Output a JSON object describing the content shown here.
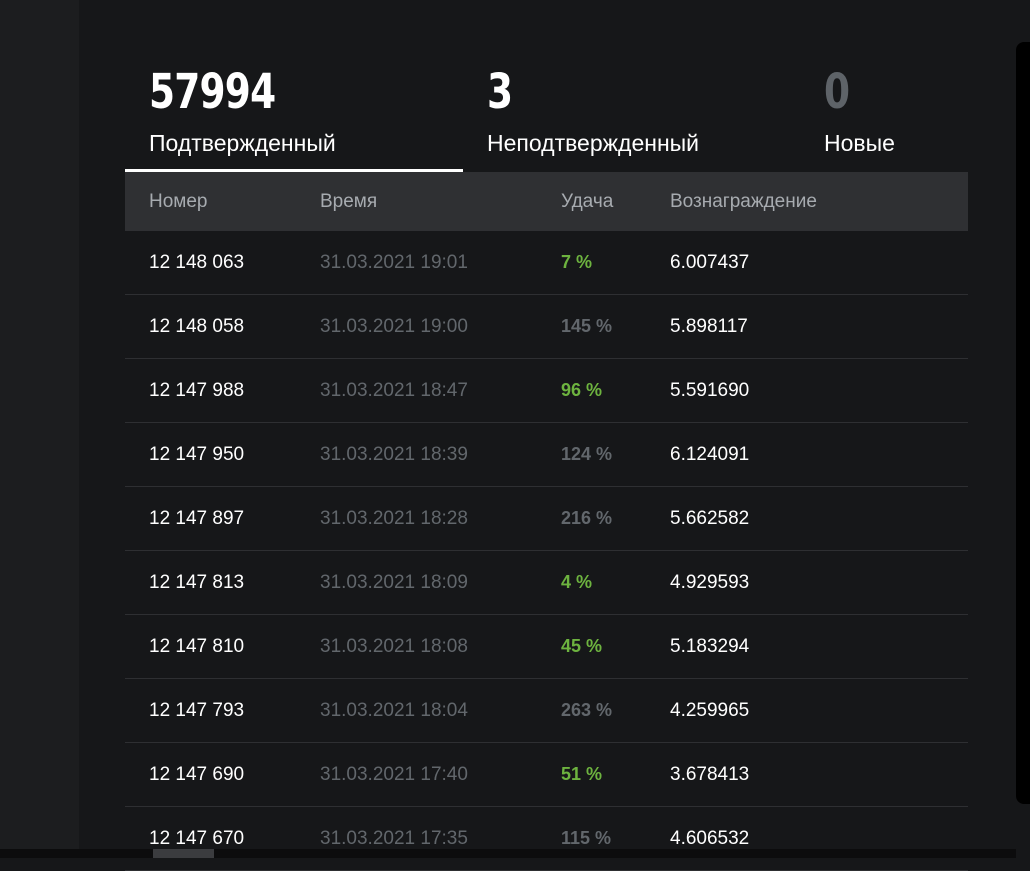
{
  "stats": {
    "confirmed": {
      "value": "57994",
      "label": "Подтвержденный"
    },
    "unconfirmed": {
      "value": "3",
      "label": "Неподтвержденный"
    },
    "new": {
      "value": "0",
      "label": "Новые"
    },
    "active_tab": "confirmed"
  },
  "table": {
    "headers": {
      "number": "Номер",
      "time": "Время",
      "luck": "Удача",
      "reward": "Вознаграждение"
    },
    "rows": [
      {
        "number": "12 148 063",
        "time": "31.03.2021 19:01",
        "luck": "7 %",
        "reward": "6.007437",
        "luck_status": "good"
      },
      {
        "number": "12 148 058",
        "time": "31.03.2021 19:00",
        "luck": "145 %",
        "reward": "5.898117",
        "luck_status": "bad"
      },
      {
        "number": "12 147 988",
        "time": "31.03.2021 18:47",
        "luck": "96 %",
        "reward": "5.591690",
        "luck_status": "good"
      },
      {
        "number": "12 147 950",
        "time": "31.03.2021 18:39",
        "luck": "124 %",
        "reward": "6.124091",
        "luck_status": "bad"
      },
      {
        "number": "12 147 897",
        "time": "31.03.2021 18:28",
        "luck": "216 %",
        "reward": "5.662582",
        "luck_status": "bad"
      },
      {
        "number": "12 147 813",
        "time": "31.03.2021 18:09",
        "luck": "4 %",
        "reward": "4.929593",
        "luck_status": "good"
      },
      {
        "number": "12 147 810",
        "time": "31.03.2021 18:08",
        "luck": "45 %",
        "reward": "5.183294",
        "luck_status": "good"
      },
      {
        "number": "12 147 793",
        "time": "31.03.2021 18:04",
        "luck": "263 %",
        "reward": "4.259965",
        "luck_status": "bad"
      },
      {
        "number": "12 147 690",
        "time": "31.03.2021 17:40",
        "luck": "51 %",
        "reward": "3.678413",
        "luck_status": "good"
      },
      {
        "number": "12 147 670",
        "time": "31.03.2021 17:35",
        "luck": "115 %",
        "reward": "4.606532",
        "luck_status": "bad"
      }
    ]
  },
  "colors": {
    "good": "#6db33f",
    "bad": "#62676c",
    "background": "#161719",
    "header": "#2f3033"
  }
}
